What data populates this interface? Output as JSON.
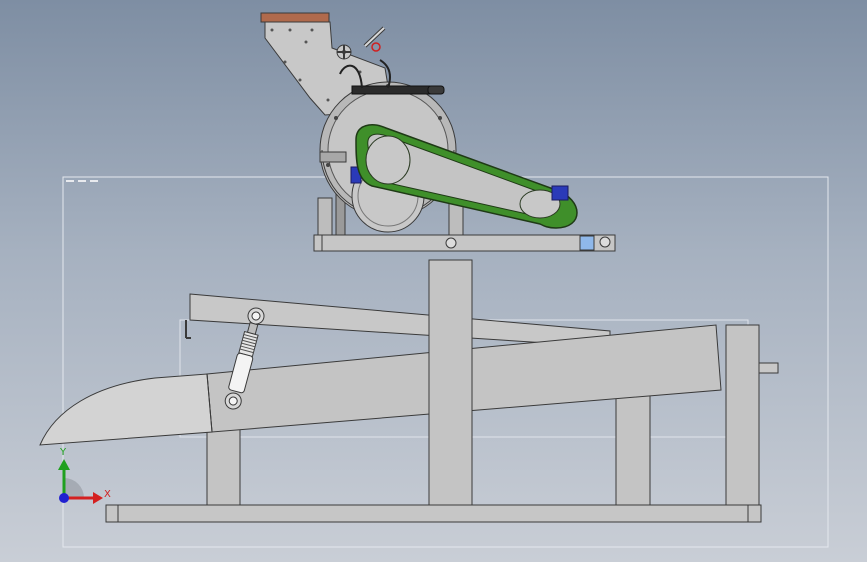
{
  "viewport": {
    "background_top": "#7e8ea3",
    "background_bottom": "#c9ced6"
  },
  "triad": {
    "x_label": "X",
    "y_label": "Y",
    "x_color": "#d42020",
    "y_color": "#1fa01f",
    "z_color": "#2020d0"
  },
  "colors": {
    "steel": "#c4c4c4",
    "steel_light": "#d4d4d4",
    "steel_dark": "#9a9a9a",
    "outline": "#3a3a3a",
    "belt_guard": "#3f8f2a",
    "motor_blue": "#2a3ab8",
    "hopper_top": "#b06a4c"
  },
  "icons": {
    "triad": "axis-triad-icon"
  }
}
